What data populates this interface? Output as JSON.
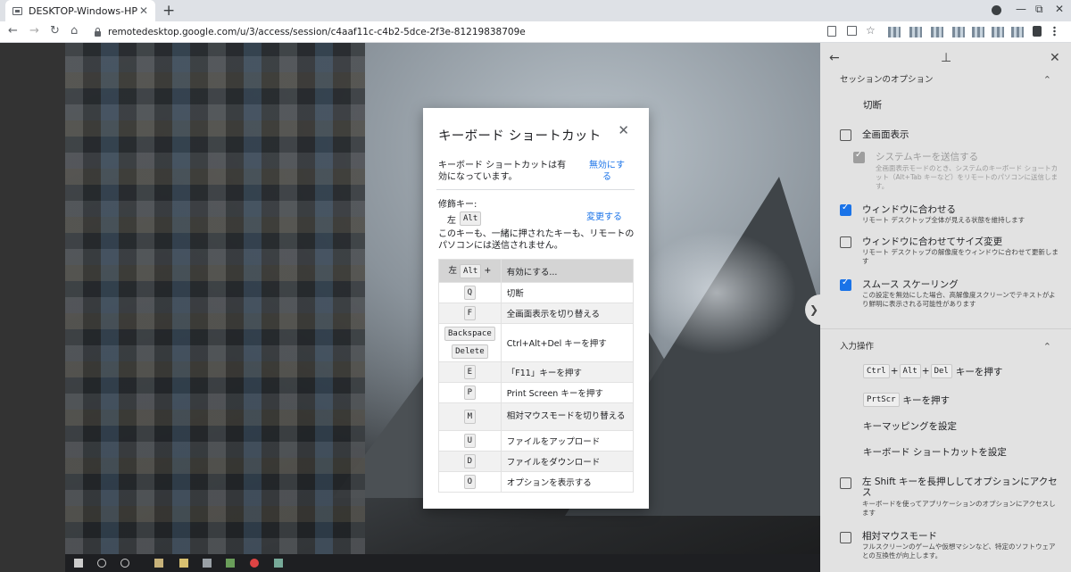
{
  "browser": {
    "tab_title": "DESKTOP-Windows-HP",
    "tab_close": "✕",
    "new_tab": "+",
    "url": "remotedesktop.google.com/u/3/access/session/c4aaf11c-c4b2-5dce-2f3e-81219838709e",
    "back": "←",
    "forward": "→",
    "reload": "↻",
    "home": "⌂",
    "bookmark": "☆",
    "minimize": "—",
    "restore": "⧉",
    "close": "✕"
  },
  "dialog": {
    "title": "キーボード ショートカット",
    "close": "✕",
    "status_text": "キーボード ショートカットは有効になっています。",
    "disable_link_line1": "無効にす",
    "disable_link_line2": "る",
    "modifier_label": "修飾キー:",
    "modifier_side": "左",
    "modifier_key": "Alt",
    "change_link": "変更する",
    "modifier_desc": "このキーも、一緒に押されたキーも、リモートのパソコンには送信されません。",
    "header_side": "左",
    "header_key": "Alt",
    "header_plus": "+",
    "header_action": "有効にする...",
    "shortcuts": [
      {
        "key": "Q",
        "action": "切断"
      },
      {
        "key": "F",
        "action": "全画面表示を切り替える"
      },
      {
        "key": "Backspace",
        "key2": "Delete",
        "action": "Ctrl+Alt+Del キーを押す"
      },
      {
        "key": "E",
        "action": "「F11」キーを押す"
      },
      {
        "key": "P",
        "action": "Print Screen キーを押す"
      },
      {
        "key": "M",
        "action": "相対マウスモードを切り替える"
      },
      {
        "key": "U",
        "action": "ファイルをアップロード"
      },
      {
        "key": "D",
        "action": "ファイルをダウンロード"
      },
      {
        "key": "O",
        "action": "オプションを表示する"
      }
    ]
  },
  "panel": {
    "back": "←",
    "pin": "⊥",
    "close": "✕",
    "session_section": "セッションのオプション",
    "disconnect": "切断",
    "fullscreen": "全画面表示",
    "send_system_keys": "システムキーを送信する",
    "send_system_keys_desc": "全画面表示モードのとき、システムのキーボード ショートカット（Alt+Tab キーなど）をリモートのパソコンに送信します。",
    "fit_window": "ウィンドウに合わせる",
    "fit_window_desc": "リモート デスクトップ全体が見える状態を維持します",
    "resize_window": "ウィンドウに合わせてサイズ変更",
    "resize_window_desc": "リモート デスクトップの解像度をウィンドウに合わせて更新します",
    "smooth_scaling": "スムース スケーリング",
    "smooth_scaling_desc": "この設定を無効にした場合、高解像度スクリーンでテキストがより鮮明に表示される可能性があります",
    "input_section": "入力操作",
    "cad_keys": [
      "Ctrl",
      "Alt",
      "Del"
    ],
    "cad_plus": "+",
    "cad_label": "キーを押す",
    "prtscr_key": "PrtScr",
    "prtscr_label": "キーを押す",
    "key_mapping": "キーマッピングを設定",
    "keyboard_shortcuts": "キーボード ショートカットを設定",
    "hold_shift": "左 Shift キーを長押ししてオプションにアクセス",
    "hold_shift_desc": "キーボードを使ってアプリケーションのオプションにアクセスします",
    "relative_mouse": "相対マウスモード",
    "relative_mouse_desc": "フルスクリーンのゲームや仮想マシンなど、特定のソフトウェアとの互換性が向上します。",
    "expand_handle": "❯",
    "section_chevron": "⌃"
  },
  "colors": {
    "accent": "#1a73e8",
    "panel_bg": "#e2e2e2"
  }
}
